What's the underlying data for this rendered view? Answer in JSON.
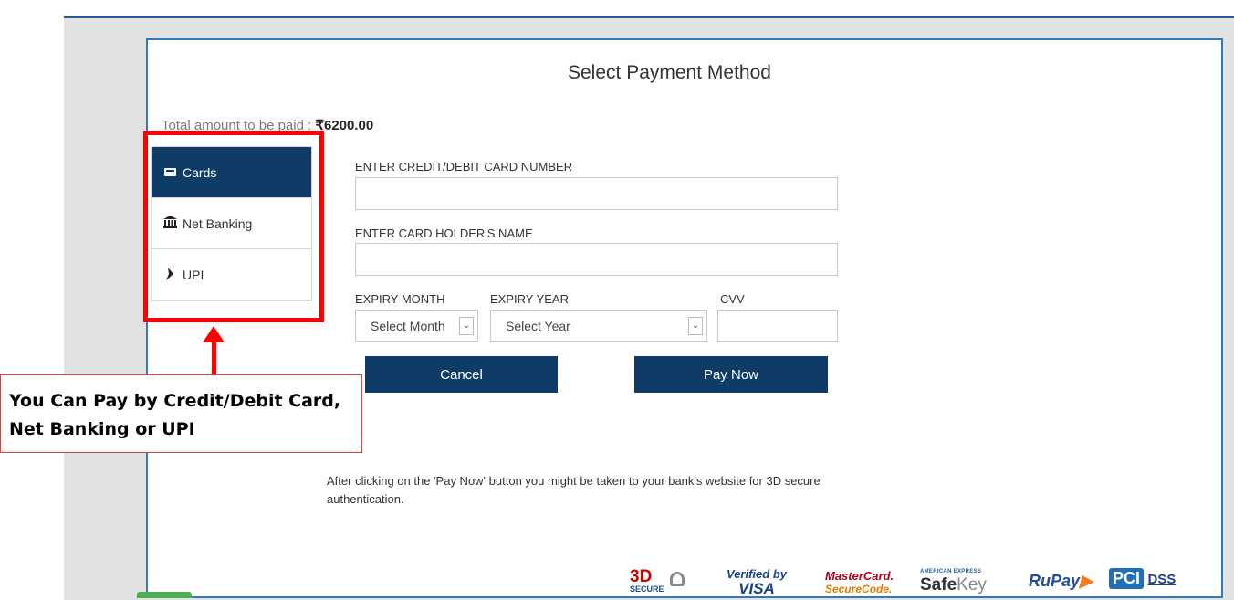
{
  "page": {
    "title": "Select Payment Method",
    "amount_label": "Total amount to be paid :",
    "amount_value": "₹6200.00"
  },
  "tabs": [
    {
      "label": "Cards",
      "icon": "credit-card-icon",
      "active": true
    },
    {
      "label": "Net Banking",
      "icon": "bank-icon",
      "active": false
    },
    {
      "label": "UPI",
      "icon": "upi-icon",
      "active": false
    }
  ],
  "form": {
    "card_number_label": "ENTER CREDIT/DEBIT CARD NUMBER",
    "card_number_value": "",
    "holder_name_label": "ENTER CARD HOLDER'S NAME",
    "holder_name_value": "",
    "expiry_month_label": "EXPIRY MONTH",
    "expiry_month_selected": "Select Month",
    "expiry_year_label": "EXPIRY YEAR",
    "expiry_year_selected": "Select Year",
    "cvv_label": "CVV",
    "cvv_value": ""
  },
  "buttons": {
    "cancel": "Cancel",
    "pay_now": "Pay Now"
  },
  "note": "After clicking on the 'Pay Now' button you might be taken to your bank's website for 3D secure authentication.",
  "annotation": {
    "text": "You Can Pay by Credit/Debit Card, Net Banking or UPI",
    "color": "#ff0000"
  },
  "security_logos": {
    "three_d": "3D",
    "three_d_sub": "SECURE",
    "visa_top": "Verified by",
    "visa_bottom": "VISA",
    "mc_top": "MasterCard.",
    "mc_bottom": "SecureCode.",
    "amex_top": "AMERICAN EXPRESS",
    "amex_safe": "Safe",
    "amex_key": "Key",
    "rupay": "RuPay",
    "pci": "PCI",
    "dss": "DSS"
  },
  "colors": {
    "primary": "#0f3c66",
    "border_accent": "#2f7bbf",
    "background": "#e2e2e2"
  }
}
